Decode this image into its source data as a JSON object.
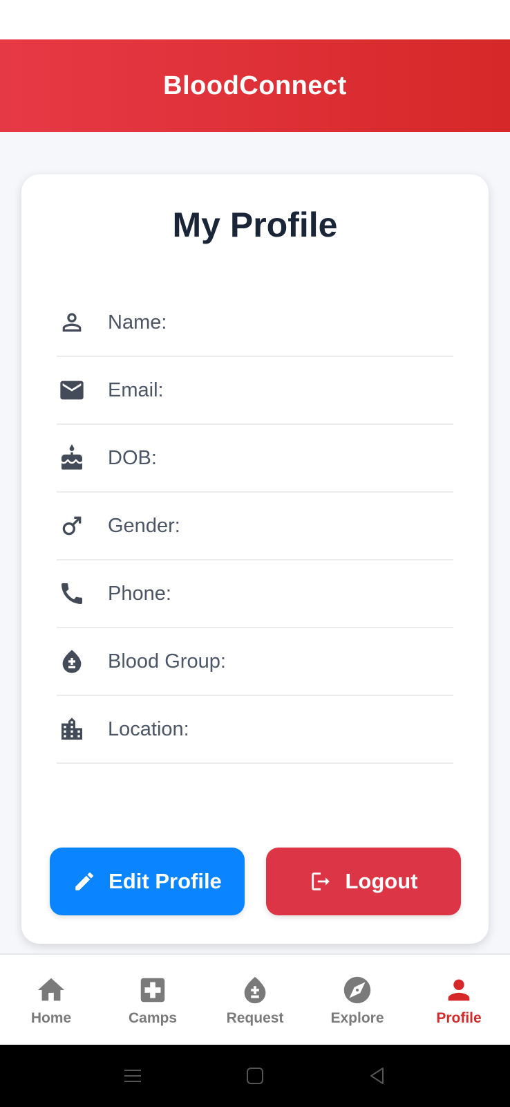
{
  "header": {
    "title": "BloodConnect"
  },
  "profile": {
    "title": "My Profile",
    "fields": [
      {
        "icon": "person-icon",
        "label": "Name:"
      },
      {
        "icon": "email-icon",
        "label": "Email:"
      },
      {
        "icon": "cake-icon",
        "label": "DOB:"
      },
      {
        "icon": "male-icon",
        "label": "Gender:"
      },
      {
        "icon": "phone-icon",
        "label": "Phone:"
      },
      {
        "icon": "blood-drop-icon",
        "label": "Blood Group:"
      },
      {
        "icon": "location-city-icon",
        "label": "Location:"
      }
    ],
    "edit_label": "Edit Profile",
    "logout_label": "Logout"
  },
  "nav": {
    "items": [
      {
        "icon": "home-icon",
        "label": "Home"
      },
      {
        "icon": "camps-icon",
        "label": "Camps"
      },
      {
        "icon": "request-icon",
        "label": "Request"
      },
      {
        "icon": "explore-icon",
        "label": "Explore"
      },
      {
        "icon": "profile-icon",
        "label": "Profile"
      }
    ],
    "active": "Profile"
  },
  "colors": {
    "header_gradient_start": "#e63946",
    "header_gradient_end": "#d62828",
    "edit_button": "#0a84ff",
    "logout_button": "#dc3545",
    "nav_active": "#d62828",
    "nav_inactive": "#7a7a7a"
  }
}
